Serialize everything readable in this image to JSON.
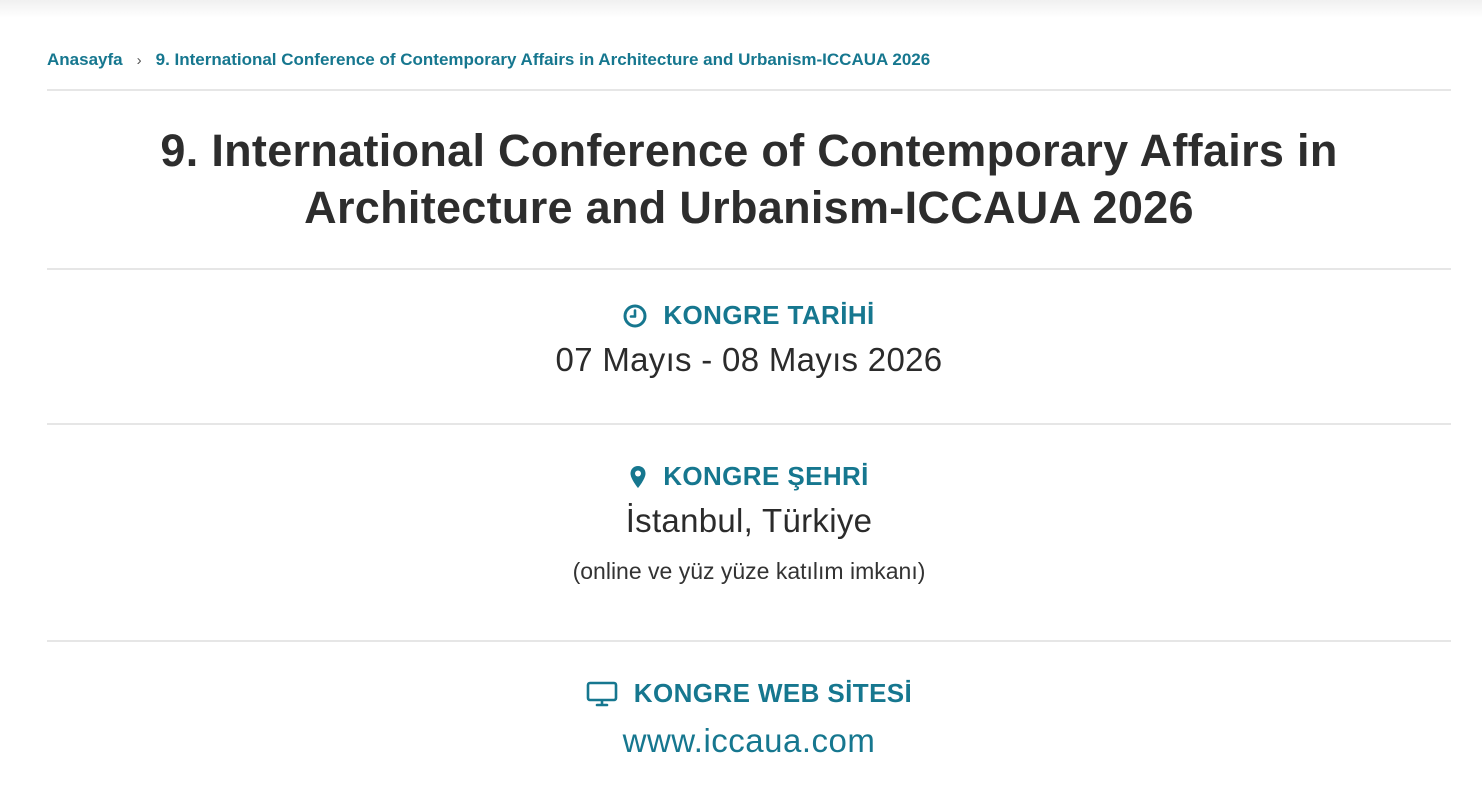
{
  "breadcrumb": {
    "home": "Anasayfa",
    "separator": "›",
    "current": "9. International Conference of Contemporary Affairs in Architecture and Urbanism-ICCAUA 2026"
  },
  "page": {
    "title_line1": "9. International Conference of Contemporary Affairs in",
    "title_line2": "Architecture and Urbanism-ICCAUA 2026"
  },
  "date_section": {
    "icon": "clock-icon",
    "heading": "KONGRE TARİHİ",
    "value": "07 Mayıs - 08 Mayıs 2026"
  },
  "city_section": {
    "icon": "map-pin-icon",
    "heading": "KONGRE ŞEHRİ",
    "value": "İstanbul, Türkiye",
    "note": "(online ve yüz yüze katılım imkanı)"
  },
  "website_section": {
    "icon": "monitor-icon",
    "heading": "KONGRE WEB SİTESİ",
    "link": "www.iccaua.com"
  },
  "colors": {
    "accent": "#16778f",
    "text": "#2d2d2d",
    "divider": "#e6e6e6"
  }
}
